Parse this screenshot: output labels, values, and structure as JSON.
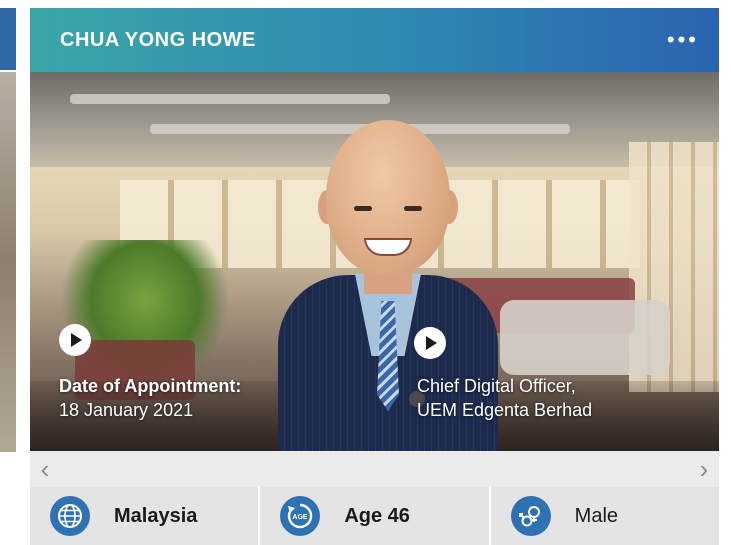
{
  "profile": {
    "name": "CHUA YONG HOWE",
    "more_label": "•••"
  },
  "photo": {
    "appointment_label": "Date of Appointment:",
    "appointment_date": "18 January 2021",
    "position_line1": "Chief Digital Officer,",
    "position_line2": "UEM Edgenta Berhad"
  },
  "scroll": {
    "left": "‹",
    "right": "›"
  },
  "facts": {
    "nationality": "Malaysia",
    "age": "Age 46",
    "age_icon_text": "AGE",
    "gender": "Male"
  },
  "icons": {
    "globe": "globe-icon",
    "age": "age-icon",
    "gender": "gender-icon",
    "play": "play-icon"
  },
  "colors": {
    "header_start": "#3aa6a8",
    "header_end": "#2a64b0",
    "icon_blue": "#2f72b4"
  }
}
